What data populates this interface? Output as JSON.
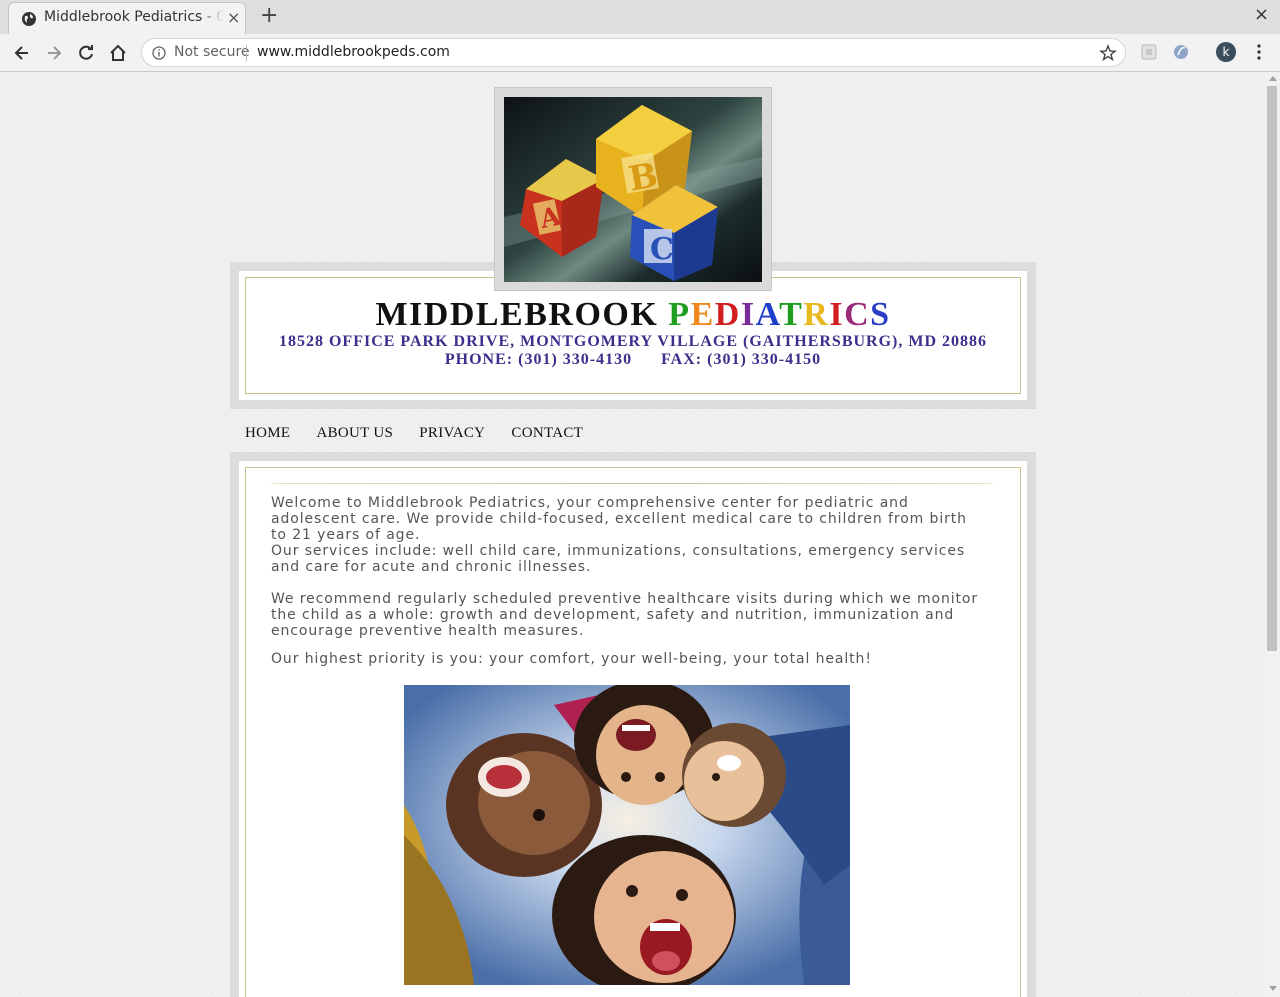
{
  "browser": {
    "tab_title": "Middlebrook Pediatrics - G",
    "tab_close": "×",
    "new_tab": "+",
    "window_close": "×",
    "security_label": "Not secure",
    "url": "www.middlebrookpeds.com",
    "profile_initial": "k",
    "icons": [
      "globe-icon",
      "back-icon",
      "forward-icon",
      "reload-icon",
      "home-icon",
      "info-icon",
      "star-icon",
      "extension-icon",
      "profile-avatar",
      "menu-icon"
    ]
  },
  "site": {
    "title_black": "MIDDLEBROOK",
    "title_colored": [
      {
        "ch": "P",
        "color": "#1e9e1e"
      },
      {
        "ch": "E",
        "color": "#f0881e"
      },
      {
        "ch": "D",
        "color": "#d21e1e"
      },
      {
        "ch": "I",
        "color": "#7a2a9a"
      },
      {
        "ch": "A",
        "color": "#1e3ec8"
      },
      {
        "ch": "T",
        "color": "#1e9e1e"
      },
      {
        "ch": "R",
        "color": "#e8b81e"
      },
      {
        "ch": "I",
        "color": "#d21e1e"
      },
      {
        "ch": "C",
        "color": "#9a2a7a"
      },
      {
        "ch": "S",
        "color": "#2a3ec8"
      }
    ],
    "address": "18528 OFFICE PARK DRIVE, MONTGOMERY VILLAGE (GAITHERSBURG), MD 20886",
    "phone": "PHONE: (301) 330-4130",
    "fax": "FAX: (301) 330-4150",
    "accent_color": "#3a2f8c"
  },
  "nav": {
    "home": "HOME",
    "about": "ABOUT US",
    "privacy": "PRIVACY",
    "contact": "CONTACT"
  },
  "content": {
    "p1": "Welcome to Middlebrook Pediatrics, your comprehensive center for pediatric and adolescent care. We provide child-focused, excellent medical care to children from birth to 21 years of age.",
    "p2": "Our services include: well child care, immunizations, consultations, emergency services and care for acute and chronic illnesses.",
    "p3": "We recommend regularly scheduled preventive healthcare visits during which we monitor the child as a whole: growth and development, safety and nutrition, immunization and encourage preventive health measures.",
    "p4": "Our highest priority is you: your comfort, your well-being, your total health!"
  }
}
